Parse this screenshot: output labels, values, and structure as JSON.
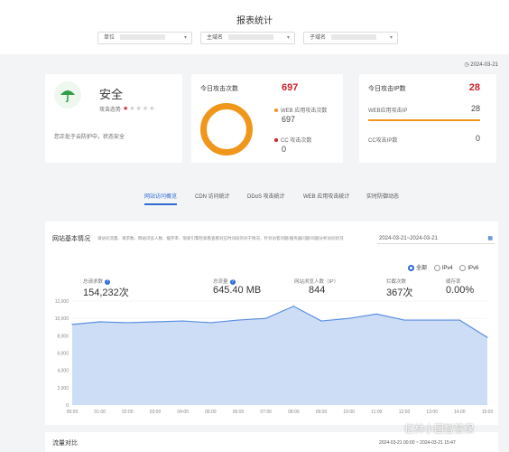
{
  "header": {
    "title": "报表统计",
    "filters": [
      {
        "label": "单位"
      },
      {
        "label": "主域名"
      },
      {
        "label": "子域名"
      }
    ]
  },
  "date_top": "2024-03-21",
  "security": {
    "status": "安全",
    "sub": "攻击态势",
    "desc": "您正处于云防护中，状态安全",
    "stars": 1,
    "stars_total": 5
  },
  "attacks": {
    "title": "今日攻击次数",
    "total": "697",
    "web_label": "WEB 应用攻击次数",
    "web_value": "697",
    "cc_label": "CC 攻击次数",
    "cc_value": "0"
  },
  "ips": {
    "title": "今日攻击IP数",
    "total": "28",
    "web_label": "WEB应用攻击IP",
    "web_value": "28",
    "cc_label": "CC攻击IP数",
    "cc_value": "0"
  },
  "tabs": [
    "网站访问概览",
    "CDN 访问统计",
    "DDoS 攻击统计",
    "WEB 应用攻击统计",
    "实时防御动态"
  ],
  "basic": {
    "title": "网站基本情况",
    "desc": "请访问流量、请求数、网站浏览人数、缓存率、限索引擎检索看查看对应时间段的对于情况，针对访客问题/服务器问题/问题分析访问状况",
    "date_range": "2024-03-21~2024-03-21",
    "radios": [
      "全部",
      "IPv4",
      "IPv6"
    ]
  },
  "stats": [
    {
      "label": "总请求数",
      "value": "154,232次"
    },
    {
      "label": "总流量",
      "value": "645.40 MB"
    },
    {
      "label": "网站浏览人数（IP）",
      "value": "844"
    },
    {
      "label": "拦截次数",
      "value": "367次"
    },
    {
      "label": "缓存率",
      "value": "0.00%"
    }
  ],
  "traffic": {
    "title": "流量对比",
    "date1": "2024-03-21 00:00 ~ 2024-03-21 15:47",
    "watermark": "亿林小园智慧保"
  },
  "chart_data": {
    "type": "area",
    "x": [
      "00:00",
      "01:00",
      "02:00",
      "03:00",
      "04:00",
      "05:00",
      "06:00",
      "07:00",
      "08:00",
      "09:00",
      "10:00",
      "11:00",
      "12:00",
      "13:00",
      "14:00",
      "15:00"
    ],
    "y_ticks": [
      "0",
      "2,000",
      "4,000",
      "6,000",
      "8,000",
      "10,000",
      "12,000"
    ],
    "ylim": [
      0,
      12000
    ],
    "values": [
      9300,
      9600,
      9500,
      9600,
      9700,
      9500,
      9800,
      10000,
      11400,
      9700,
      10000,
      10500,
      9800,
      9800,
      9800,
      7800
    ],
    "colors": {
      "line": "#5b8fe0",
      "fill": "#c8d9f5"
    }
  }
}
